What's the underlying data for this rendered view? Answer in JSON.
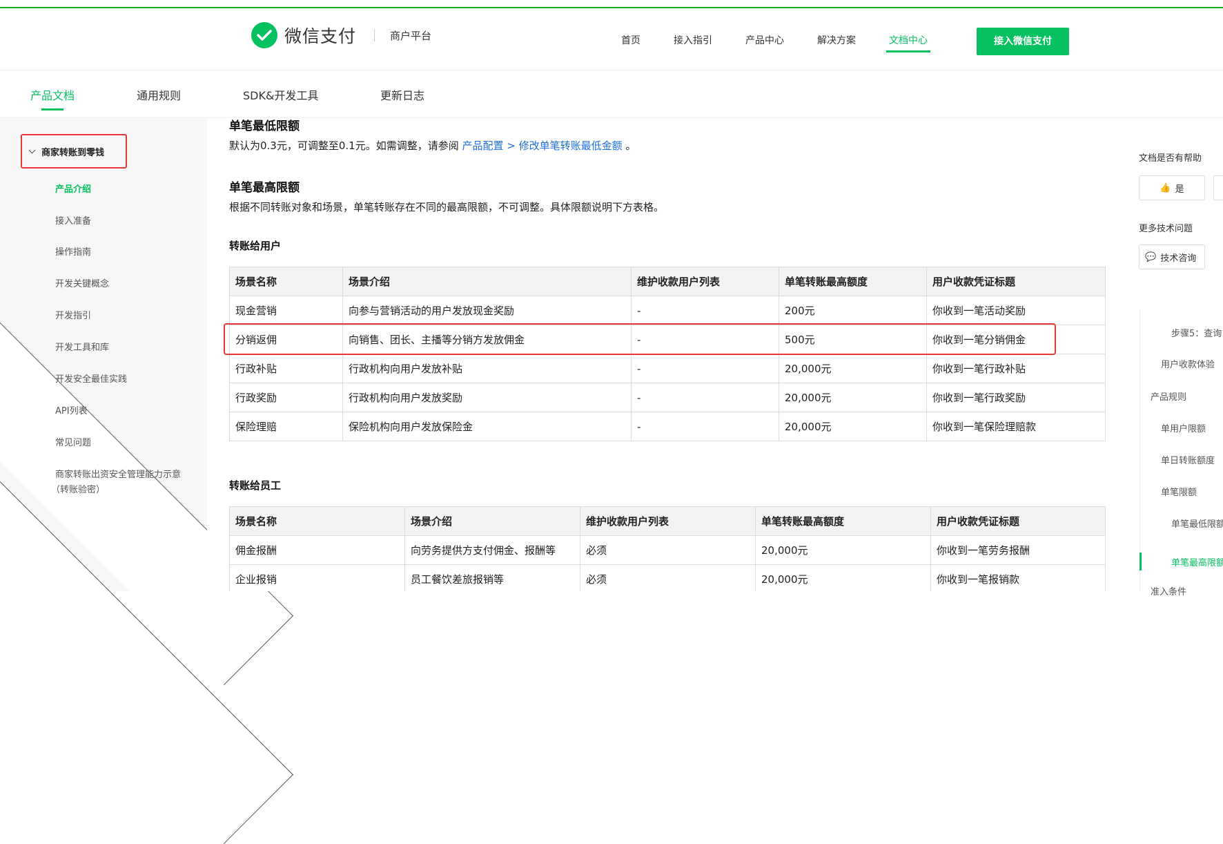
{
  "brand": {
    "name": "微信支付",
    "sub": "商户平台"
  },
  "nav": {
    "items": [
      "首页",
      "接入指引",
      "产品中心",
      "解决方案",
      "文档中心"
    ],
    "cta": "接入微信支付"
  },
  "tabs": [
    "产品文档",
    "通用规则",
    "SDK&开发工具",
    "更新日志"
  ],
  "sidebar": {
    "group": "商家转账到零钱",
    "items": [
      "产品介绍",
      "接入准备",
      "操作指南",
      "开发关键概念",
      "开发指引",
      "开发工具和库",
      "开发安全最佳实践",
      "API列表",
      "常见问题",
      "商家转账出资安全管理能力示意",
      "（转账验密）"
    ]
  },
  "content": {
    "min_title": "单笔最低限额",
    "min_text": "默认为0.3元，可调整至0.1元。如需调整，请参阅 ",
    "min_link": "产品配置 > 修改单笔转账最低金额",
    "min_tail": " 。",
    "max_title": "单笔最高限额",
    "max_text": "根据不同转账对象和场景，单笔转账存在不同的最高限额，不可调整。具体限额说明下方表格。",
    "users_title": "转账给用户",
    "employees_title": "转账给员工",
    "headers": [
      "场景名称",
      "场景介绍",
      "维护收款用户列表",
      "单笔转账最高额度",
      "用户收款凭证标题"
    ],
    "users_rows": [
      [
        "现金营销",
        "向参与营销活动的用户发放现金奖励",
        "-",
        "200元",
        "你收到一笔活动奖励"
      ],
      [
        "分销返佣",
        "向销售、团长、主播等分销方发放佣金",
        "-",
        "500元",
        "你收到一笔分销佣金"
      ],
      [
        "行政补贴",
        "行政机构向用户发放补贴",
        "-",
        "20,000元",
        "你收到一笔行政补贴"
      ],
      [
        "行政奖励",
        "行政机构向用户发放奖励",
        "-",
        "20,000元",
        "你收到一笔行政奖励"
      ],
      [
        "保险理赔",
        "保险机构向用户发放保险金",
        "-",
        "20,000元",
        "你收到一笔保险理赔款"
      ]
    ],
    "emp_rows": [
      [
        "佣金报酬",
        "向劳务提供方支付佣金、报酬等",
        "必须",
        "20,000元",
        "你收到一笔劳务报酬"
      ],
      [
        "企业报销",
        "员工餐饮差旅报销等",
        "必须",
        "20,000元",
        "你收到一笔报销款"
      ]
    ]
  },
  "right": {
    "helpful": "文档是否有帮助",
    "yes": "是",
    "more": "更多技术问题",
    "consult": "技术咨询",
    "toc": [
      "步骤5：查询",
      "用户收款体验",
      "产品规则",
      "单用户限额",
      "单日转账额度",
      "单笔限额",
      "单笔最低限额",
      "单笔最高限额",
      "准入条件"
    ]
  }
}
